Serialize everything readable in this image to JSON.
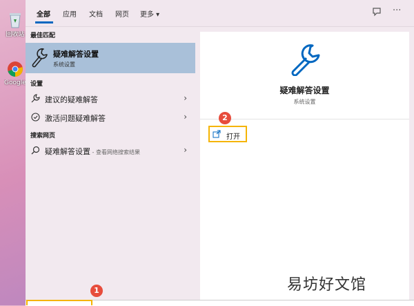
{
  "desktop": {
    "recycle_label": "回收站",
    "chrome_label": "Google Chrome"
  },
  "tabs": [
    "全部",
    "应用",
    "文档",
    "网页",
    "更多 ▾"
  ],
  "topbar_icons": [
    "feedback-icon",
    "more-icon"
  ],
  "left": {
    "best_match_title": "最佳匹配",
    "best_match": {
      "title": "疑难解答设置",
      "subtitle": "系统设置"
    },
    "settings_title": "设置",
    "settings_items": [
      {
        "label": "建议的疑难解答"
      },
      {
        "label": "激活问题疑难解答"
      }
    ],
    "web_title": "搜索网页",
    "web_item": {
      "label": "疑难解答设置",
      "hint": " - 查看网络搜索结果"
    }
  },
  "right": {
    "title": "疑难解答设置",
    "subtitle": "系统设置",
    "open_label": "打开"
  },
  "badges": {
    "one": "1",
    "two": "2"
  },
  "watermark": "易坊好文馆",
  "colors": {
    "accent": "#0067c0",
    "highlight": "#f5b400",
    "badge": "#e74c3c",
    "selected": "#a9c0d9"
  }
}
